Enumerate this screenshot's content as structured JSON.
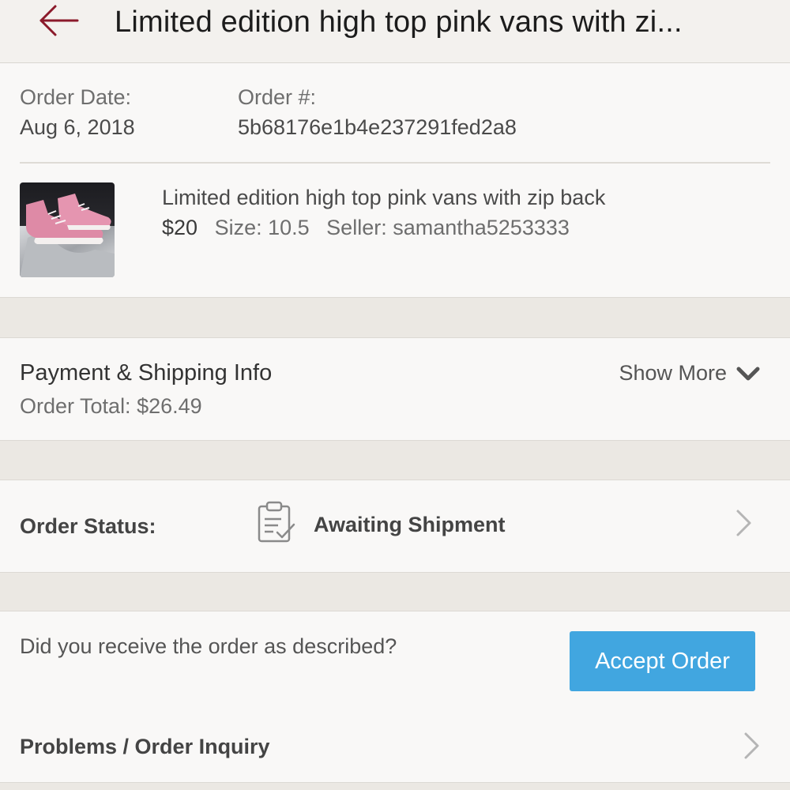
{
  "header": {
    "title": "Limited edition high top pink vans with zi..."
  },
  "order": {
    "date_label": "Order Date:",
    "date_value": "Aug 6, 2018",
    "number_label": "Order #:",
    "number_value": "5b68176e1b4e237291fed2a8"
  },
  "item": {
    "title": "Limited edition high top pink vans with zip back",
    "price": "$20",
    "size": "Size: 10.5",
    "seller": "Seller: samantha5253333"
  },
  "payment": {
    "title": "Payment & Shipping Info",
    "total": "Order Total: $26.49",
    "show_more": "Show More"
  },
  "status": {
    "label": "Order Status:",
    "value": "Awaiting Shipment"
  },
  "receive": {
    "question": "Did you receive the order as described?",
    "accept_label": "Accept Order"
  },
  "problems": {
    "label": "Problems / Order Inquiry"
  },
  "colors": {
    "accent_back": "#8b1a2b",
    "button_blue": "#41a6e0",
    "background": "#ebe8e3",
    "card": "#f9f8f7"
  },
  "icons": [
    "back-arrow-icon",
    "chevron-down-icon",
    "clipboard-check-icon",
    "chevron-right-icon"
  ]
}
